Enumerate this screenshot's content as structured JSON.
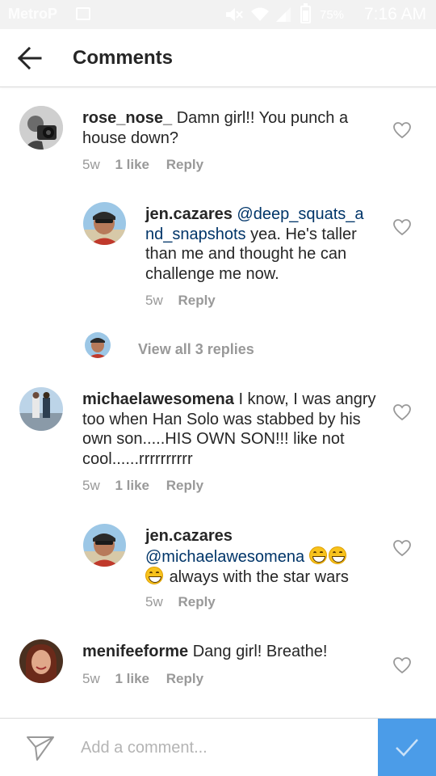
{
  "status_bar": {
    "carrier": "MetroP",
    "battery": "75%",
    "time": "7:16 AM",
    "icons": [
      "image-icon",
      "mute-icon",
      "wifi-icon",
      "signal-icon",
      "battery-icon"
    ]
  },
  "header": {
    "title": "Comments",
    "back_icon": "arrow-left-icon"
  },
  "comments": [
    {
      "username": "rose_nose_",
      "text": "Damn girl!! You punch a house down?",
      "time": "5w",
      "likes": "1 like",
      "reply": "Reply"
    },
    {
      "username": "jen.cazares",
      "mention": "@deep_squats_and_snapshots",
      "text": "yea. He's taller than me and thought he can challenge me now.",
      "time": "5w",
      "reply": "Reply"
    },
    {
      "view_replies": "View all 3 replies"
    },
    {
      "username": "michaelawesomena",
      "text": "I know, I was angry too when Han Solo was stabbed by his own son.....HIS OWN SON!!! like not cool......rrrrrrrrrr",
      "time": "5w",
      "likes": "1 like",
      "reply": "Reply"
    },
    {
      "username": "jen.cazares",
      "mention": "@michaelawesomena",
      "text": "always with the star wars",
      "emoji": "grinning-face-emoji",
      "time": "5w",
      "reply": "Reply"
    },
    {
      "username": "menifeeforme",
      "text": "Dang girl! Breathe!",
      "time": "5w",
      "likes": "1 like",
      "reply": "Reply"
    }
  ],
  "composer": {
    "placeholder": "Add a comment...",
    "send_icon": "paper-plane-icon",
    "post_icon": "checkmark-icon"
  },
  "colors": {
    "accent": "#4b9ce8",
    "mention": "#003569",
    "meta_gray": "#999999",
    "divider": "#dbdbdb"
  }
}
